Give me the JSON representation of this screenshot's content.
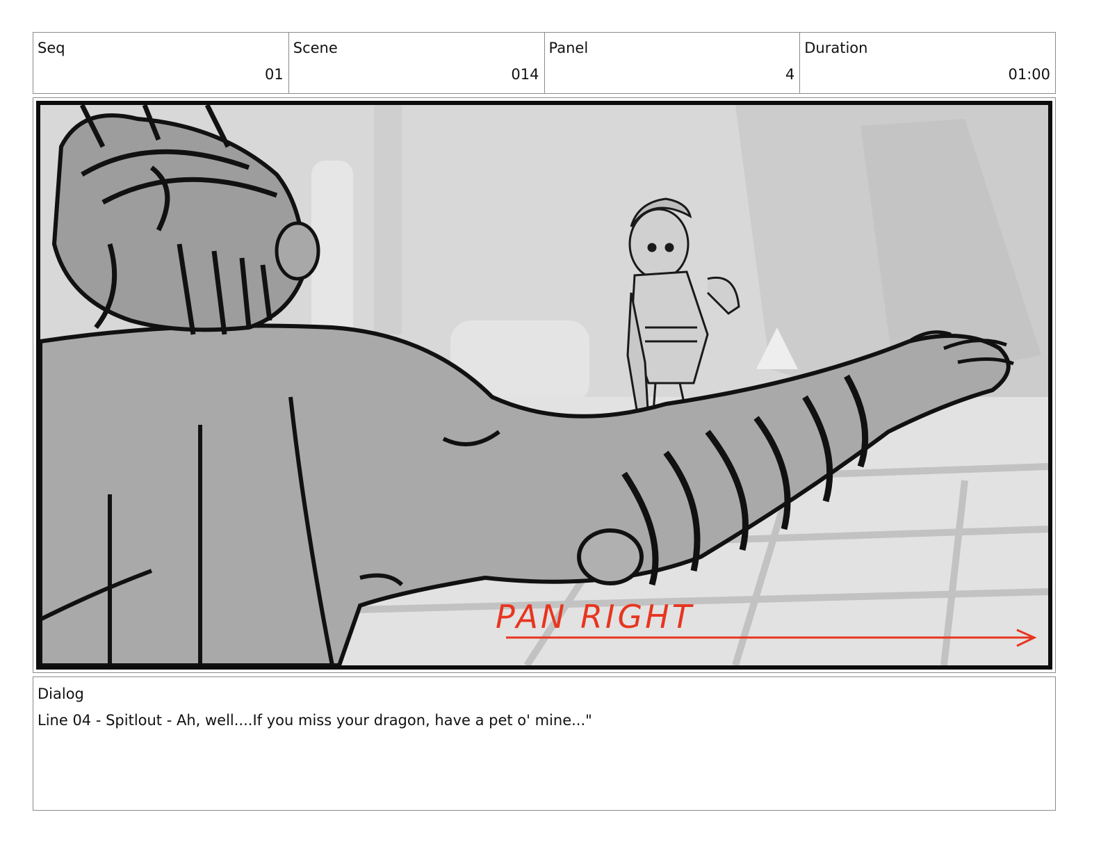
{
  "header": {
    "seq": {
      "label": "Seq",
      "value": "01"
    },
    "scene": {
      "label": "Scene",
      "value": "014"
    },
    "panel": {
      "label": "Panel",
      "value": "4"
    },
    "duration": {
      "label": "Duration",
      "value": "01:00"
    }
  },
  "panel_image": {
    "annotation": "PAN RIGHT",
    "annotation_color": "#e8351f",
    "frame_color": "#0d0d0d"
  },
  "dialog": {
    "label": "Dialog",
    "text": "Line 04 - Spitlout - Ah, well....If you miss your dragon, have a pet o' mine...\""
  }
}
